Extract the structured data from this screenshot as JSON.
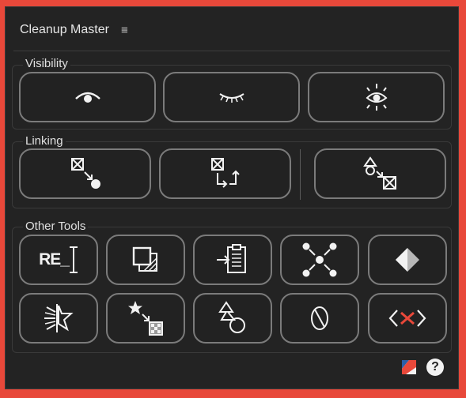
{
  "panel": {
    "title": "Cleanup Master",
    "menu_icon": "hamburger-menu-icon"
  },
  "groups": {
    "visibility": "Visibility",
    "linking": "Linking",
    "other_tools": "Other Tools"
  },
  "visibility_buttons": [
    "eye-open-icon",
    "eye-closed-icon",
    "eye-bright-icon"
  ],
  "linking_buttons": [
    "link-to-null-icon",
    "swap-link-icon",
    "link-shapes-icon"
  ],
  "other_tools_buttons": [
    "rename-icon",
    "precompose-icon",
    "paste-into-icon",
    "center-anchor-icon",
    "keyframe-icon",
    "burst-icon",
    "star-to-layer-icon",
    "shapes-icon",
    "null-object-icon",
    "remove-expressions-icon"
  ],
  "other_tools_text": {
    "rename": "RE_"
  },
  "footer": {
    "logo_icon": "brand-logo-icon",
    "help": "?"
  },
  "colors": {
    "background": "#232323",
    "button_border": "#7b7b7b",
    "accent_red": "#e8483a",
    "icon": "#f2f2f2"
  }
}
